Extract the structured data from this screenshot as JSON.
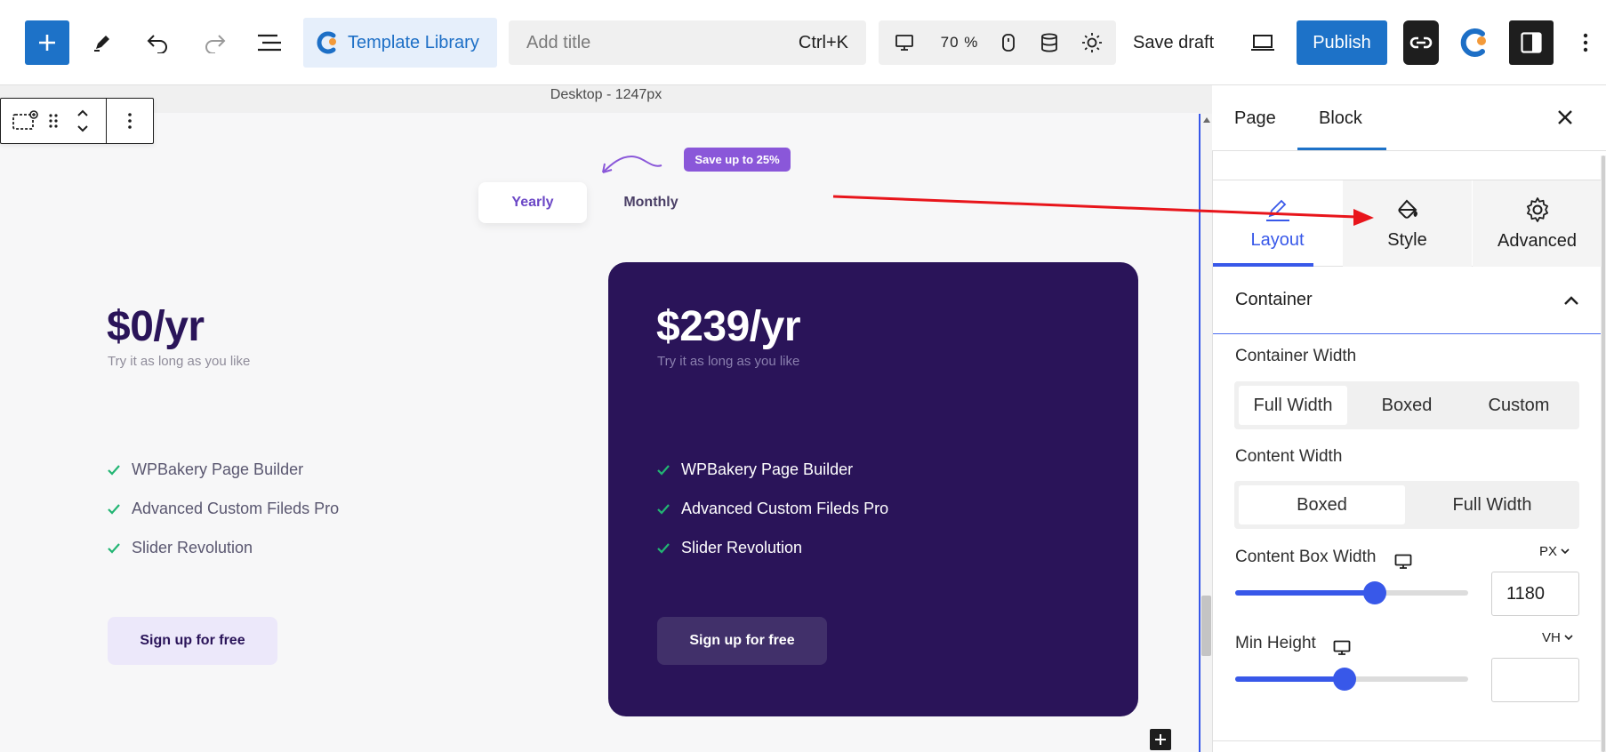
{
  "colors": {
    "accent": "#1d72c8",
    "wp_blue": "#3858e9",
    "pro_card": "#2a1459",
    "badge": "#8a57d9",
    "check": "#22b573",
    "arrow": "#e8151b"
  },
  "toolbar": {
    "template_library_label": "Template Library",
    "title_placeholder": "Add title",
    "title_shortcut": "Ctrl+K",
    "zoom": "70 %",
    "save_draft_label": "Save draft",
    "publish_label": "Publish"
  },
  "canvas": {
    "device_label": "Desktop - 1247px",
    "pricing": {
      "save_badge": "Save up to 25%",
      "toggle": {
        "yearly": "Yearly",
        "monthly": "Monthly"
      },
      "plans": [
        {
          "price": "$0/yr",
          "subtitle": "Try it as long as you like",
          "features": [
            "WPBakery Page Builder",
            "Advanced Custom Fileds Pro",
            "Slider Revolution"
          ],
          "cta": "Sign up for free"
        },
        {
          "price": "$239/yr",
          "subtitle": "Try it as long as you like",
          "features": [
            "WPBakery Page Builder",
            "Advanced Custom Fileds Pro",
            "Slider Revolution"
          ],
          "cta": "Sign up for free"
        }
      ]
    }
  },
  "panel": {
    "tabs": {
      "page": "Page",
      "block": "Block"
    },
    "layout_tabs": {
      "layout": "Layout",
      "style": "Style",
      "advanced": "Advanced"
    },
    "section_title": "Container",
    "container_width": {
      "label": "Container Width",
      "options": [
        "Full Width",
        "Boxed",
        "Custom"
      ],
      "selected": "Full Width"
    },
    "content_width": {
      "label": "Content Width",
      "options": [
        "Boxed",
        "Full Width"
      ],
      "selected": "Boxed"
    },
    "content_box_width": {
      "label": "Content Box Width",
      "unit": "PX",
      "value": "1180",
      "slider_fraction": 0.6
    },
    "min_height": {
      "label": "Min Height",
      "unit": "VH",
      "value": "",
      "slider_fraction": 0.47
    }
  }
}
